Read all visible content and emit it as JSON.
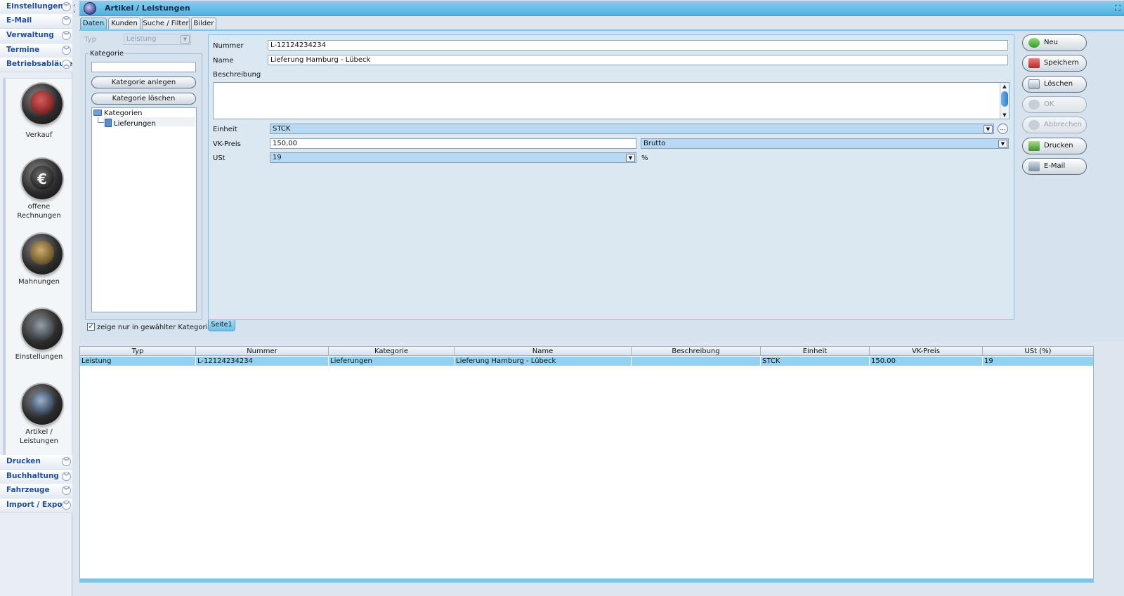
{
  "nav": {
    "top_items": [
      {
        "label": "Einstellungen"
      },
      {
        "label": "E-Mail"
      },
      {
        "label": "Verwaltung"
      },
      {
        "label": "Termine"
      },
      {
        "label": "Betriebsabläufe"
      }
    ],
    "tiles": [
      {
        "label": "Verkauf",
        "icon": "verkauf-icon"
      },
      {
        "label": "offene Rechnungen",
        "icon": "euro-icon"
      },
      {
        "label": "Mahnungen",
        "icon": "mahnungen-icon"
      },
      {
        "label": "Einstellungen",
        "icon": "globe-icon"
      },
      {
        "label": "Artikel / Leistungen",
        "icon": "tag-icon"
      }
    ],
    "bottom_items": [
      {
        "label": "Drucken"
      },
      {
        "label": "Buchhaltung"
      },
      {
        "label": "Fahrzeuge"
      },
      {
        "label": "Import / Export"
      }
    ]
  },
  "window": {
    "title": "Artikel / Leistungen",
    "tabs": [
      {
        "label": "Daten",
        "active": true
      },
      {
        "label": "Kunden",
        "active": false
      },
      {
        "label": "Suche / Filter",
        "active": false
      },
      {
        "label": "Bilder",
        "active": false
      }
    ]
  },
  "left": {
    "typ_label": "Typ",
    "typ_value": "Leistung",
    "kategorie_legend": "Kategorie",
    "kategorie_input": "",
    "btn_anlegen": "Kategorie anlegen",
    "btn_loeschen": "Kategorie löschen",
    "tree_root": "Kategorien",
    "tree_child": "Lieferungen",
    "checkbox_label": "zeige nur in gewählter Kategorie",
    "checkbox_checked": true
  },
  "form": {
    "nummer_label": "Nummer",
    "nummer_value": "L-12124234234",
    "name_label": "Name",
    "name_value": "Lieferung Hamburg - Lübeck",
    "beschreibung_label": "Beschreibung",
    "beschreibung_value": "",
    "einheit_label": "Einheit",
    "einheit_value": "STCK",
    "vkpreis_label": "VK-Preis",
    "vkpreis_value": "150,00",
    "brutto_value": "Brutto",
    "ust_label": "USt",
    "ust_value": "19",
    "ust_unit": "%",
    "page_tab": "Seite1"
  },
  "actions": [
    {
      "label": "Neu",
      "enabled": true,
      "icon": "neu-icon"
    },
    {
      "label": "Speichern",
      "enabled": true,
      "icon": "save-icon"
    },
    {
      "label": "Löschen",
      "enabled": true,
      "icon": "delete-icon"
    },
    {
      "label": "OK",
      "enabled": false,
      "icon": "ok-icon"
    },
    {
      "label": "Abbrechen",
      "enabled": false,
      "icon": "cancel-icon"
    },
    {
      "label": "Drucken",
      "enabled": true,
      "icon": "print-icon"
    },
    {
      "label": "E-Mail",
      "enabled": true,
      "icon": "mail-icon"
    }
  ],
  "grid": {
    "columns": [
      "Typ",
      "Nummer",
      "Kategorie",
      "Name",
      "Beschreibung",
      "Einheit",
      "VK-Preis",
      "USt (%)"
    ],
    "rows": [
      [
        "Leistung",
        "L-12124234234",
        "Lieferungen",
        "Lieferung Hamburg - Lübeck",
        "",
        "STCK",
        "150.00",
        "19"
      ]
    ]
  },
  "colors": {
    "accent": "#4fb1e0",
    "selection": "#8fd3f1",
    "nav_text": "#1f4e9a"
  }
}
